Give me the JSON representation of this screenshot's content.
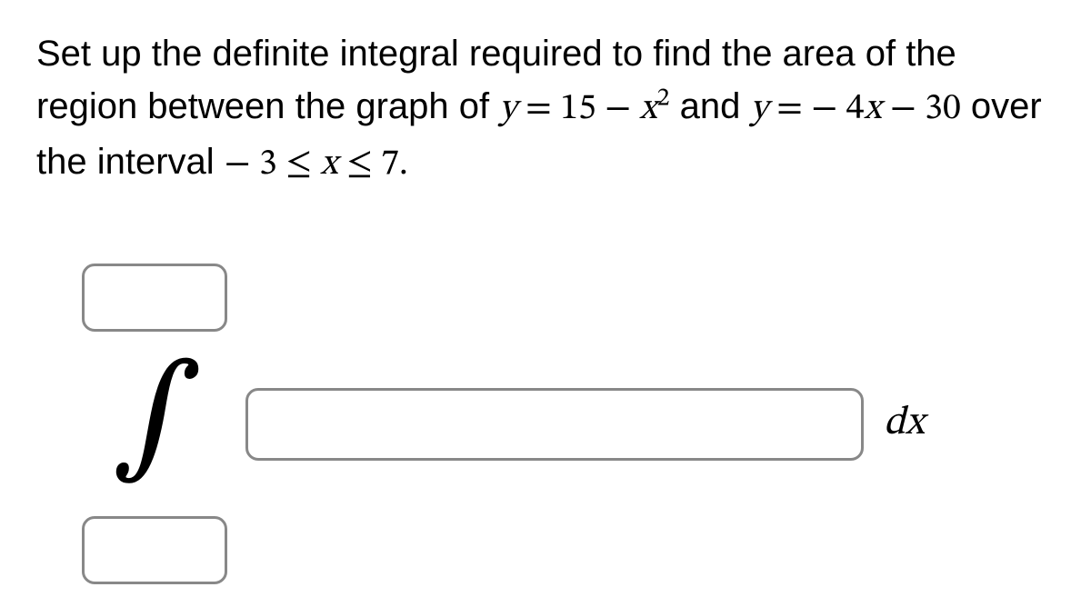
{
  "question": {
    "part1": "Set up the definite integral required to find the area of the region between the graph of ",
    "eq1_lhs_var": "y",
    "eq_sign": " = ",
    "eq1_rhs_const": "15",
    "minus": " − ",
    "eq1_rhs_var": "x",
    "eq1_rhs_exp": "2",
    "part2": " and ",
    "eq2_lhs_var": "y",
    "eq2_rhs": " − 4",
    "eq2_rhs_var": "x",
    "eq2_rhs2": " − 30",
    "part3": " over the interval ",
    "interval_a": "− 3 ≤ ",
    "interval_var": "x",
    "interval_b": " ≤ 7.",
    "integral_symbol": "∫",
    "dx_d": "d",
    "dx_x": "x"
  }
}
